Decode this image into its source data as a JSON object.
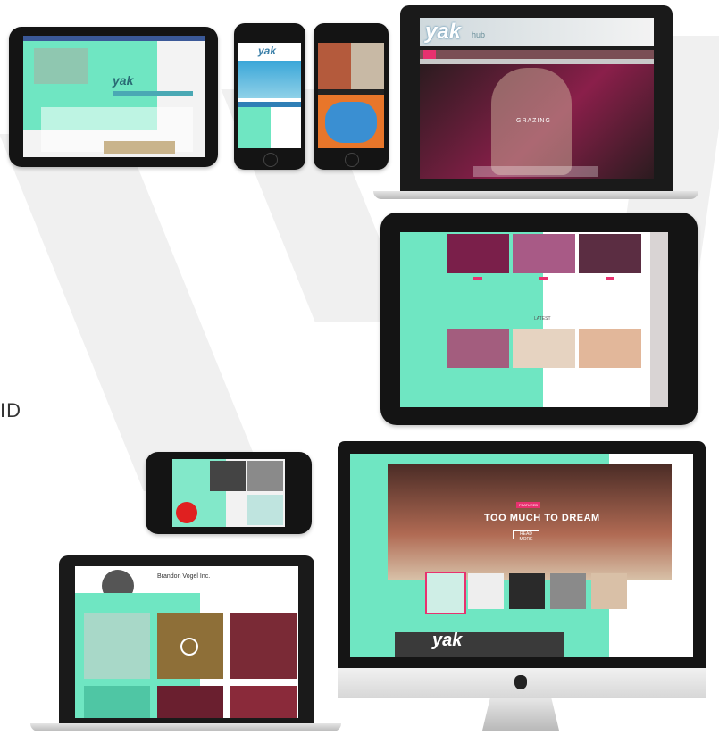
{
  "side_text": "ID",
  "brand": {
    "logo_text": "yak",
    "logo_sub": "hub",
    "accent": "#6fe6c2",
    "pink": "#e8316f"
  },
  "tablet_small": {
    "logo_text": "yak"
  },
  "phone": {
    "logo_text": "yak"
  },
  "laptop_top": {
    "logo_text": "yak",
    "logo_sub": "hub",
    "hero_label": "GRAZING"
  },
  "tablet_large": {
    "section_label": "LATEST"
  },
  "imac": {
    "hero_tag": "FEATURED",
    "hero_title": "TOO MUCH TO DREAM",
    "hero_button": "READ MORE",
    "footer_logo": "yak",
    "apple_icon": "apple-logo-icon"
  },
  "laptop_bottom": {
    "profile_name": "Brandon Vogel Inc."
  },
  "icons": {
    "play": "play-icon",
    "apple": "apple-logo-icon"
  }
}
